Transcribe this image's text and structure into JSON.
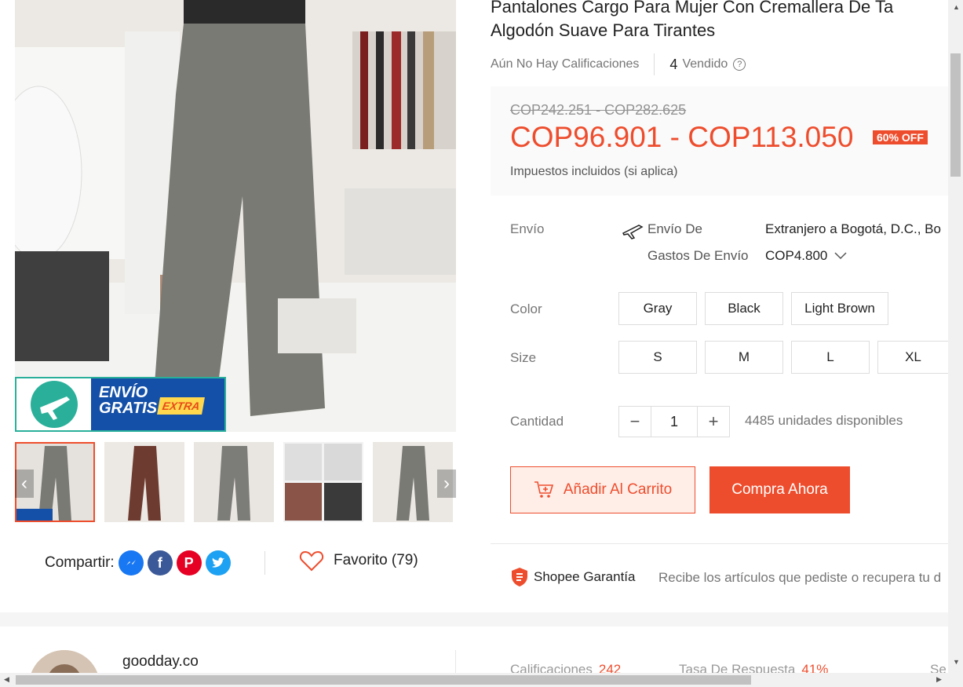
{
  "product": {
    "title_line1": "Pantalones Cargo Para Mujer Con Cremallera De Ta",
    "title_line2": "Algodón Suave Para Tirantes",
    "ratings": "Aún No Hay Calificaciones",
    "sold_count": "4",
    "sold_label": "Vendido",
    "old_price": "COP242.251 - COP282.625",
    "price": "COP96.901 - COP113.050",
    "discount": "60% OFF",
    "tax_note": "Impuestos incluidos (si aplica)"
  },
  "shipping": {
    "label": "Envío",
    "from_key": "Envío De",
    "from_value": "Extranjero a Bogotá, D.C., Bo",
    "cost_key": "Gastos De Envío",
    "cost_value": "COP4.800"
  },
  "color": {
    "label": "Color",
    "options": [
      "Gray",
      "Black",
      "Light Brown"
    ]
  },
  "size": {
    "label": "Size",
    "options": [
      "S",
      "M",
      "L",
      "XL"
    ]
  },
  "quantity": {
    "label": "Cantidad",
    "value": "1",
    "stock": "4485 unidades disponibles"
  },
  "actions": {
    "add_to_cart": "Añadir Al Carrito",
    "buy_now": "Compra Ahora"
  },
  "guarantee": {
    "title": "Shopee Garantía",
    "desc": "Recibe los artículos que pediste o recupera tu d"
  },
  "badge": {
    "line1": "ENVÍO",
    "line2": "GRATIS",
    "extra": "EXTRA"
  },
  "share": {
    "label": "Compartir:",
    "favorite": "Favorito (79)"
  },
  "seller": {
    "name": "goodday.co",
    "stat1_label": "Calificaciones",
    "stat1_value": "242",
    "stat2_label": "Tasa De Respuesta",
    "stat2_value": "41%",
    "stat3_label": "Se"
  },
  "colors": {
    "accent": "#ee4d2d",
    "messenger": "#1877f2",
    "facebook": "#3b5998",
    "pinterest": "#e60023",
    "twitter": "#1da1f2"
  }
}
